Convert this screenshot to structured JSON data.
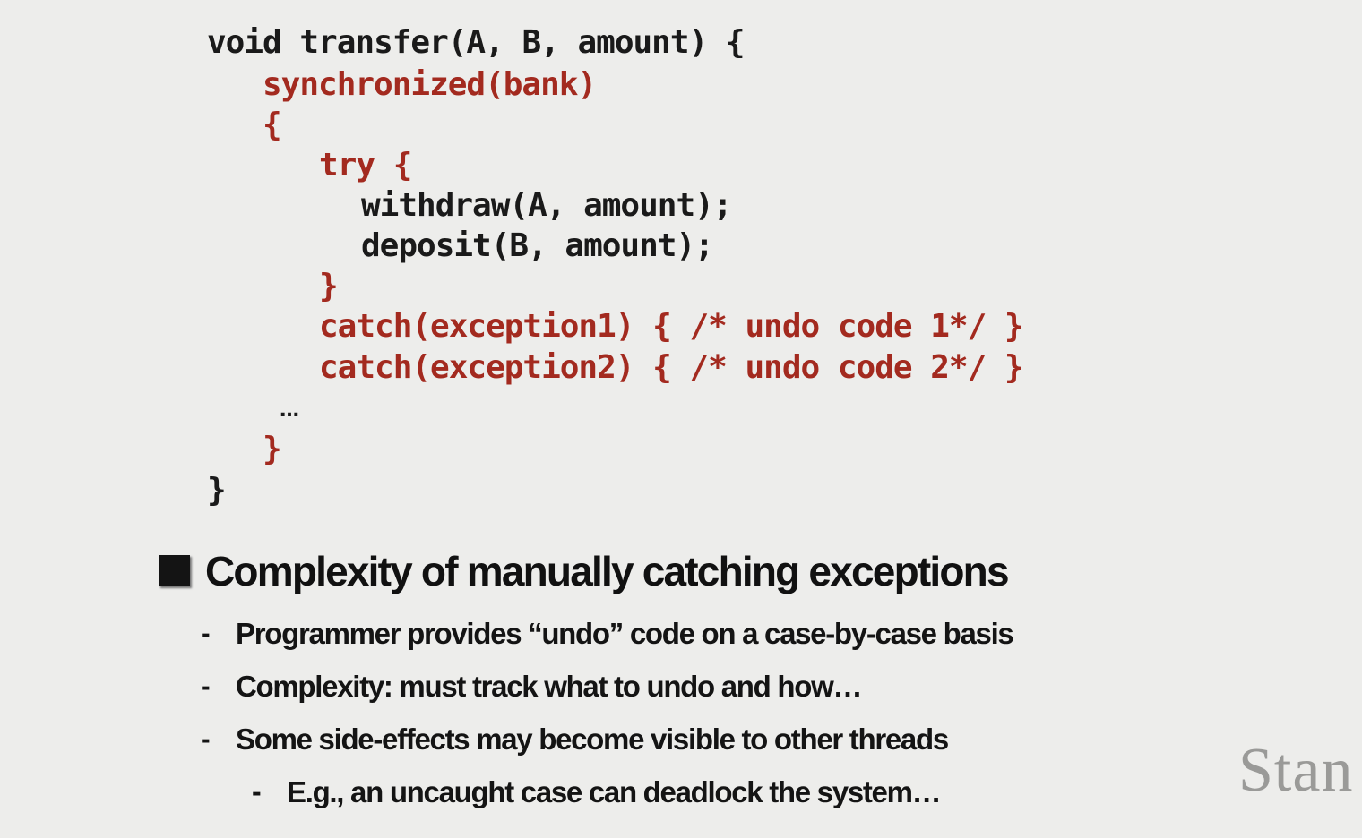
{
  "code": {
    "lines": [
      "void transfer(A, B, amount) {",
      "synchronized(bank)",
      "{",
      "try {",
      "withdraw(A, amount);",
      "deposit(B, amount);",
      "}",
      "catch(exception1) { /* undo code 1*/ }",
      "catch(exception2) { /* undo code 2*/ }",
      "…",
      "}",
      "}"
    ],
    "highlight_color": "#a32a1f",
    "text_color": "#1a1a1a"
  },
  "bullet": {
    "heading": "Complexity of manually catching exceptions",
    "sub_items": [
      "Programmer provides “undo” code on a case-by-case basis",
      "Complexity: must track what to undo and how…",
      "Some side-effects may become visible to other threads"
    ],
    "sub_sub_items": [
      "E.g., an uncaught case can deadlock the system…"
    ],
    "dash": "-"
  },
  "logo": {
    "text": "Stan"
  }
}
